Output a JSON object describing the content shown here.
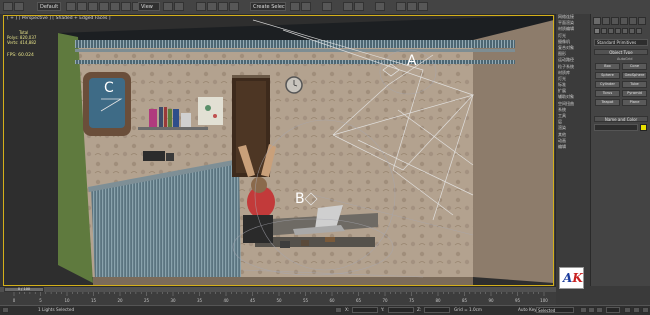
{
  "toolbar": {
    "workspace_combo": "Default",
    "view_combo": "View",
    "selection_set": "Create Selection Se"
  },
  "viewport": {
    "label": "[ + ] [ Perspective ] [ Shaded + Edged Faces ]",
    "stats": {
      "title": "Total",
      "polys": "Polys: 820,037",
      "verts": "Verts: 414,882"
    },
    "fps": "FPS: 60.024",
    "callouts": [
      "A",
      "B",
      "C"
    ],
    "accent_color": "#d4b01a"
  },
  "scene_labels": {
    "a": "A",
    "b": "B",
    "c": "C"
  },
  "right_labels": [
    "网络连接",
    "平面渲染",
    "材质编辑",
    "灯光",
    "摄像机",
    "复合对象",
    "图形",
    "运动路径",
    "粒子系统",
    "材质库",
    "灯光",
    "标准",
    "扩展",
    "辅助对象",
    "空间扭曲",
    "系统",
    "工具",
    "层",
    "渲染",
    "其他",
    "动画",
    "编辑"
  ],
  "command_panel": {
    "category_dropdown": "Standard Primitives",
    "object_type_label": "Object Type",
    "autogrid_label": "AutoGrid",
    "primitives": [
      "Box",
      "Cone",
      "Sphere",
      "GeoSphere",
      "Cylinder",
      "Tube",
      "Torus",
      "Pyramid",
      "Teapot",
      "Plane"
    ],
    "name_color_label": "Name and Color",
    "name_value": "",
    "object_color": "#e8e000"
  },
  "timeline": {
    "frame_readout": "0 / 100",
    "ticks": [
      "0",
      "5",
      "10",
      "15",
      "20",
      "25",
      "30",
      "35",
      "40",
      "45",
      "50",
      "55",
      "60",
      "65",
      "70",
      "75",
      "80",
      "85",
      "90",
      "95",
      "100"
    ]
  },
  "status_bar": {
    "objects_selected": "1 Lights Selected",
    "x_label": "X:",
    "y_label": "Y:",
    "z_label": "Z:",
    "grid_text": "Grid = 1.0cm",
    "add_time_tag": "Add Time Tag",
    "autokey_label": "Auto Key",
    "selected_combo": "Selected",
    "set_key_label": "Set Key",
    "key_filters_label": "Key Filters..."
  }
}
